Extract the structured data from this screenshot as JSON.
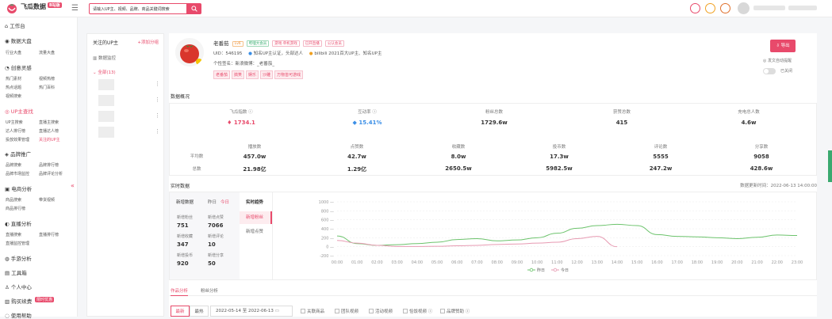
{
  "app": {
    "name": "飞瓜数据",
    "badge": "B站版",
    "logo_icon": "melon-logo-icon",
    "accent": "#e84a6b"
  },
  "search": {
    "placeholder": "请输入UP主、视频、品牌、商品关键词搜索"
  },
  "sidebar": {
    "workbench": "工作台",
    "sections": [
      {
        "title": "数据大盘",
        "items": [
          "行业大盘",
          "流量大盘"
        ]
      },
      {
        "title": "创意灵感",
        "items": [
          "热门素材",
          "视频热榜",
          "热点话题",
          "热门百科",
          "视频搜索"
        ]
      },
      {
        "title": "UP主查找",
        "items": [
          "UP主搜索",
          "直播主搜索",
          "达人排行榜",
          "直播达人榜",
          "投放效果管理",
          "关注的UP主"
        ]
      },
      {
        "title": "品牌推广",
        "items": [
          "品牌搜索",
          "品牌排行榜",
          "品牌市场监控",
          "品牌评论分析"
        ]
      },
      {
        "title": "电商分析",
        "items": [
          "商品搜索",
          "带货视频",
          "商品排行榜"
        ]
      },
      {
        "title": "直播分析",
        "items": [
          "直播搜索",
          "直播排行榜",
          "直播监控管理"
        ]
      },
      {
        "title": "手游分析",
        "items": []
      },
      {
        "title": "工具箱",
        "items": []
      },
      {
        "title": "个人中心",
        "items": []
      },
      {
        "title": "购买续费",
        "items": [],
        "badge": "限时优惠"
      },
      {
        "title": "使用帮助",
        "items": []
      }
    ]
  },
  "follow_panel": {
    "title": "关注的UP主",
    "add_label": "+添加分组",
    "data_monitor": "数据监控",
    "all_label": "全部(13)"
  },
  "profile": {
    "name": "老番茄",
    "level_tag": "Lv6",
    "tags": [
      "哔哩大会员",
      "游戏·单机游戏",
      "已开直播",
      "公认会员"
    ],
    "uid_label": "UID：",
    "uid": "546195",
    "verify": "知名UP主认证，头部达人",
    "honor": "bilibili 2021百大UP主、知名UP主",
    "signature_label": "个性签名：",
    "signature": "新浪微博：_老番茄_",
    "hashtags": [
      "老番茄",
      "搞笑",
      "娱乐",
      "沙雕",
      "万物皆可游戏"
    ],
    "export_label": "导出",
    "notice_label": "发文自动提醒",
    "toggle_label": "已关闭"
  },
  "overview": {
    "title": "数据概况",
    "top": [
      {
        "label": "飞瓜指数",
        "value": "1734.1",
        "color": "#e84a6b"
      },
      {
        "label": "互动率",
        "value": "15.41%",
        "color": "#3a8ee6"
      },
      {
        "label": "粉丝总数",
        "value": "1729.6w"
      },
      {
        "label": "获赞总数",
        "value": "415"
      },
      {
        "label": "充电总人数",
        "value": "4.6w"
      }
    ],
    "columns": [
      "播放数",
      "点赞数",
      "收藏数",
      "投币数",
      "评论数",
      "分享数"
    ],
    "row_labels": [
      "平均数",
      "总数"
    ],
    "avg": [
      "457.0w",
      "42.7w",
      "8.0w",
      "17.3w",
      "5555",
      "9058"
    ],
    "total": [
      "21.98亿",
      "1.29亿",
      "2650.5w",
      "5982.5w",
      "247.2w",
      "428.6w"
    ]
  },
  "realtime": {
    "title": "实时数据",
    "update_time": "数据更新时间：2022-06-13 14:00:00",
    "tabs": [
      "新增数据",
      "昨日",
      "今日"
    ],
    "stats": [
      {
        "label": "新增粉丝",
        "value": "751"
      },
      {
        "label": "新增点赞",
        "value": "7066"
      },
      {
        "label": "新增收藏",
        "value": "347"
      },
      {
        "label": "新增评论",
        "value": "10"
      },
      {
        "label": "新增投币",
        "value": "920"
      },
      {
        "label": "新增分享",
        "value": "50"
      }
    ],
    "trend_title": "实时趋势",
    "trend_items": [
      "新增粉丝",
      "新增点赞"
    ]
  },
  "chart_data": {
    "type": "line",
    "x": [
      "00:00",
      "01:00",
      "02:00",
      "03:00",
      "04:00",
      "05:00",
      "06:00",
      "07:00",
      "08:00",
      "09:00",
      "10:00",
      "11:00",
      "12:00",
      "13:00",
      "14:00",
      "15:00",
      "16:00",
      "17:00",
      "18:00",
      "19:00",
      "20:00",
      "21:00",
      "22:00",
      "23:00"
    ],
    "ylim": [
      -200,
      1000
    ],
    "yticks": [
      -200,
      0,
      200,
      400,
      600,
      800,
      1000
    ],
    "series": [
      {
        "name": "昨日",
        "color": "#6cc36c",
        "values": [
          240,
          70,
          30,
          45,
          70,
          100,
          160,
          180,
          130,
          150,
          200,
          300,
          410,
          470,
          500,
          470,
          270,
          230,
          220,
          200,
          180,
          210,
          260,
          250
        ]
      },
      {
        "name": "今日",
        "color": "#e79ab2",
        "values": [
          140,
          80,
          30,
          5,
          5,
          10,
          20,
          30,
          50,
          60,
          80,
          100,
          180,
          230,
          0
        ]
      }
    ],
    "legend": "bottom-center"
  },
  "bottom_tabs": [
    "作品分析",
    "粉丝分析"
  ],
  "filters": {
    "buttons": [
      "最新",
      "最热"
    ],
    "date_range": "2022-05-14 至 2022-06-13",
    "checkboxes": [
      "关联商品",
      "团队视频",
      "活动视频",
      "恰饭视频",
      "品牌赞助"
    ]
  }
}
